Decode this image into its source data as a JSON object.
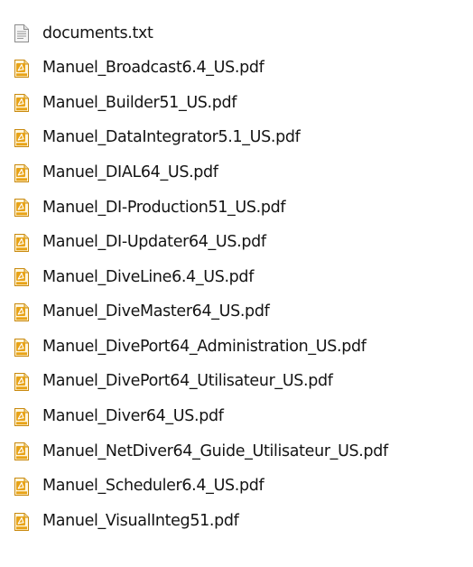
{
  "files": [
    {
      "name": "documents.txt",
      "icon": "text-file-icon",
      "type": "txt"
    },
    {
      "name": "Manuel_Broadcast6.4_US.pdf",
      "icon": "pdf-file-icon",
      "type": "pdf"
    },
    {
      "name": "Manuel_Builder51_US.pdf",
      "icon": "pdf-file-icon",
      "type": "pdf"
    },
    {
      "name": "Manuel_DataIntegrator5.1_US.pdf",
      "icon": "pdf-file-icon",
      "type": "pdf"
    },
    {
      "name": "Manuel_DIAL64_US.pdf",
      "icon": "pdf-file-icon",
      "type": "pdf"
    },
    {
      "name": "Manuel_DI-Production51_US.pdf",
      "icon": "pdf-file-icon",
      "type": "pdf"
    },
    {
      "name": "Manuel_DI-Updater64_US.pdf",
      "icon": "pdf-file-icon",
      "type": "pdf"
    },
    {
      "name": "Manuel_DiveLine6.4_US.pdf",
      "icon": "pdf-file-icon",
      "type": "pdf"
    },
    {
      "name": "Manuel_DiveMaster64_US.pdf",
      "icon": "pdf-file-icon",
      "type": "pdf"
    },
    {
      "name": "Manuel_DivePort64_Administration_US.pdf",
      "icon": "pdf-file-icon",
      "type": "pdf"
    },
    {
      "name": "Manuel_DivePort64_Utilisateur_US.pdf",
      "icon": "pdf-file-icon",
      "type": "pdf"
    },
    {
      "name": "Manuel_Diver64_US.pdf",
      "icon": "pdf-file-icon",
      "type": "pdf"
    },
    {
      "name": "Manuel_NetDiver64_Guide_Utilisateur_US.pdf",
      "icon": "pdf-file-icon",
      "type": "pdf"
    },
    {
      "name": "Manuel_Scheduler6.4_US.pdf",
      "icon": "pdf-file-icon",
      "type": "pdf"
    },
    {
      "name": "Manuel_VisualInteg51.pdf",
      "icon": "pdf-file-icon",
      "type": "pdf"
    }
  ],
  "colors": {
    "pdf_icon_accent": "#e8a317",
    "pdf_icon_border": "#c98a10",
    "text_icon_page": "#f2f2f2",
    "text_icon_border": "#8a8a8a"
  }
}
